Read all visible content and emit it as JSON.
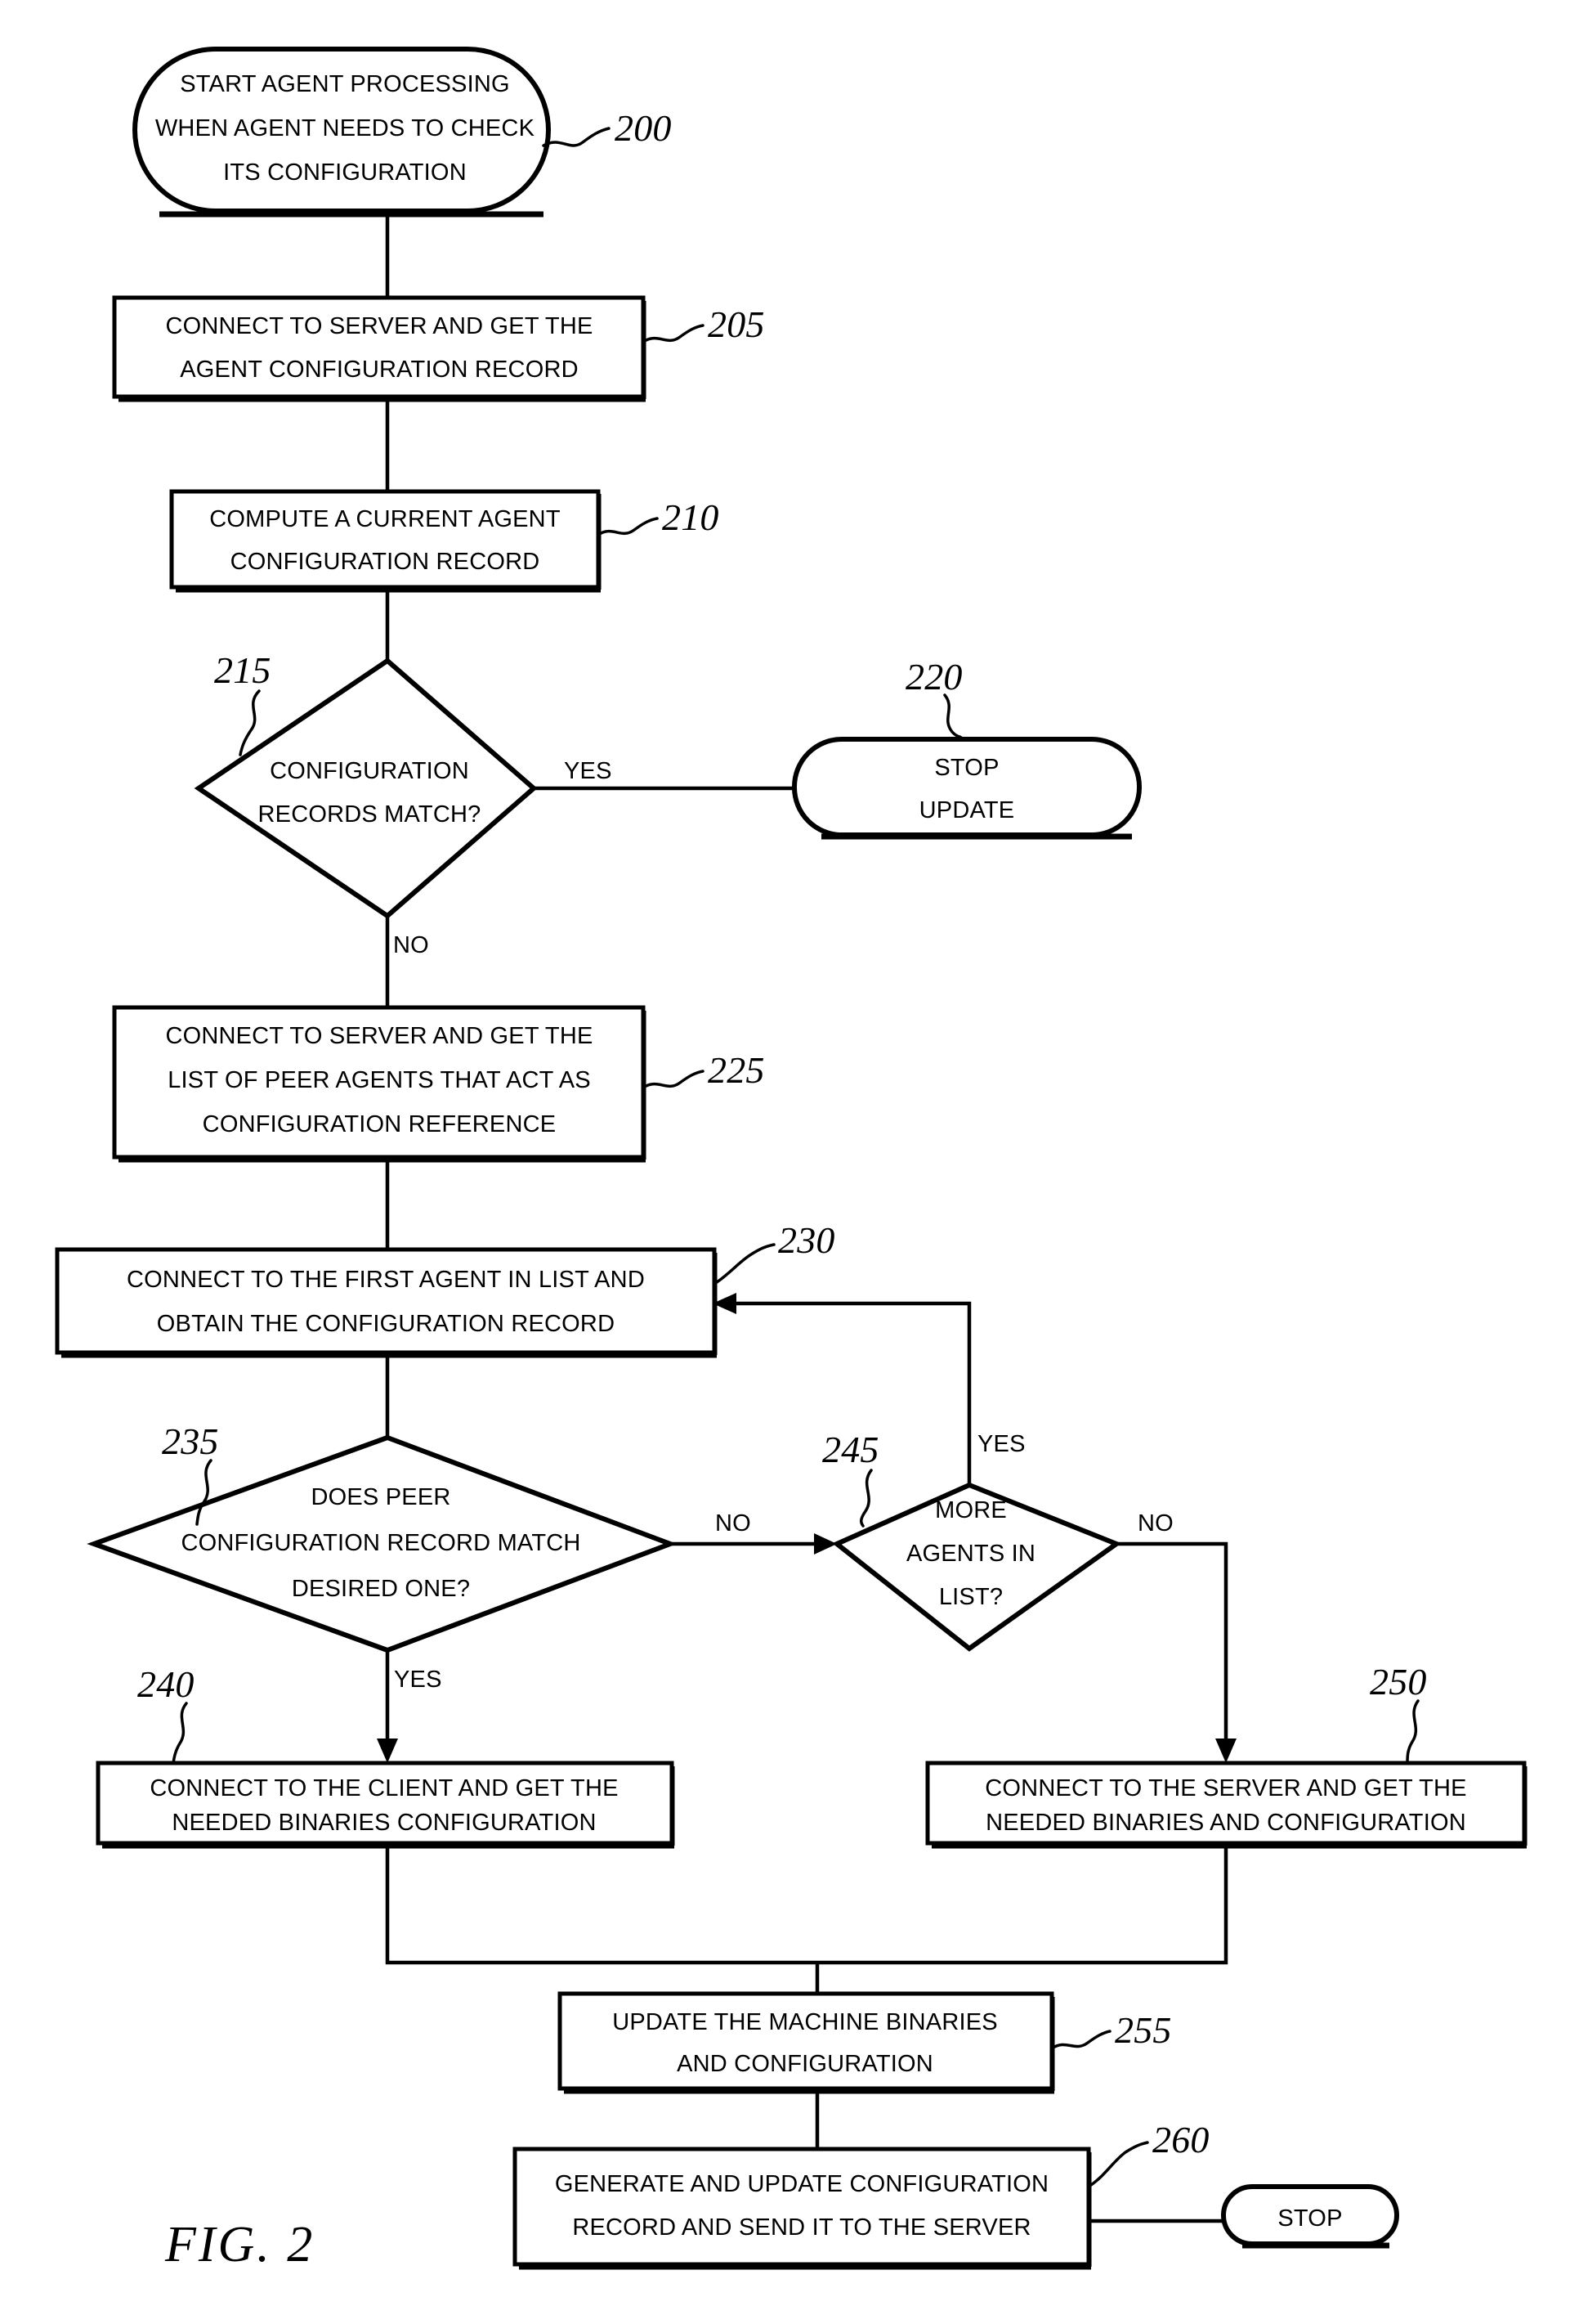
{
  "figure": {
    "caption": "FIG. 2",
    "title": "Agent configuration update process flowchart"
  },
  "nodes": {
    "n200": {
      "ref": "200",
      "shape": "terminator",
      "lines": [
        "START AGENT PROCESSING",
        "WHEN AGENT NEEDS TO CHECK",
        "ITS CONFIGURATION"
      ]
    },
    "n205": {
      "ref": "205",
      "shape": "process",
      "lines": [
        "CONNECT TO SERVER AND GET THE",
        "AGENT CONFIGURATION RECORD"
      ]
    },
    "n210": {
      "ref": "210",
      "shape": "process",
      "lines": [
        "COMPUTE A CURRENT AGENT",
        "CONFIGURATION RECORD"
      ]
    },
    "n215": {
      "ref": "215",
      "shape": "decision",
      "lines": [
        "CONFIGURATION",
        "RECORDS MATCH?"
      ]
    },
    "n220": {
      "ref": "220",
      "shape": "terminator",
      "lines": [
        "STOP",
        "UPDATE"
      ]
    },
    "n225": {
      "ref": "225",
      "shape": "process",
      "lines": [
        "CONNECT TO SERVER AND GET THE",
        "LIST OF PEER AGENTS THAT ACT AS",
        "CONFIGURATION REFERENCE"
      ]
    },
    "n230": {
      "ref": "230",
      "shape": "process",
      "lines": [
        "CONNECT TO THE FIRST AGENT IN LIST AND",
        "OBTAIN THE CONFIGURATION RECORD"
      ]
    },
    "n235": {
      "ref": "235",
      "shape": "decision",
      "lines": [
        "DOES PEER",
        "CONFIGURATION RECORD MATCH",
        "DESIRED ONE?"
      ]
    },
    "n240": {
      "ref": "240",
      "shape": "process",
      "lines": [
        "CONNECT TO THE CLIENT AND GET THE",
        "NEEDED BINARIES CONFIGURATION"
      ]
    },
    "n245": {
      "ref": "245",
      "shape": "decision",
      "lines": [
        "MORE",
        "AGENTS IN",
        "LIST?"
      ]
    },
    "n250": {
      "ref": "250",
      "shape": "process",
      "lines": [
        "CONNECT TO THE SERVER AND GET THE",
        "NEEDED BINARIES AND CONFIGURATION"
      ]
    },
    "n255": {
      "ref": "255",
      "shape": "process",
      "lines": [
        "UPDATE THE MACHINE BINARIES",
        "AND CONFIGURATION"
      ]
    },
    "n260": {
      "ref": "260",
      "shape": "process",
      "lines": [
        "GENERATE AND UPDATE CONFIGURATION",
        "RECORD AND SEND IT TO THE SERVER"
      ]
    },
    "n265": {
      "ref": "",
      "shape": "terminator",
      "lines": [
        "STOP"
      ]
    }
  },
  "edge_labels": {
    "e215_yes": "YES",
    "e215_no": "NO",
    "e235_no": "NO",
    "e235_yes": "YES",
    "e245_yes": "YES",
    "e245_no": "NO"
  },
  "colors": {
    "ink": "#000000",
    "paper": "#ffffff"
  }
}
